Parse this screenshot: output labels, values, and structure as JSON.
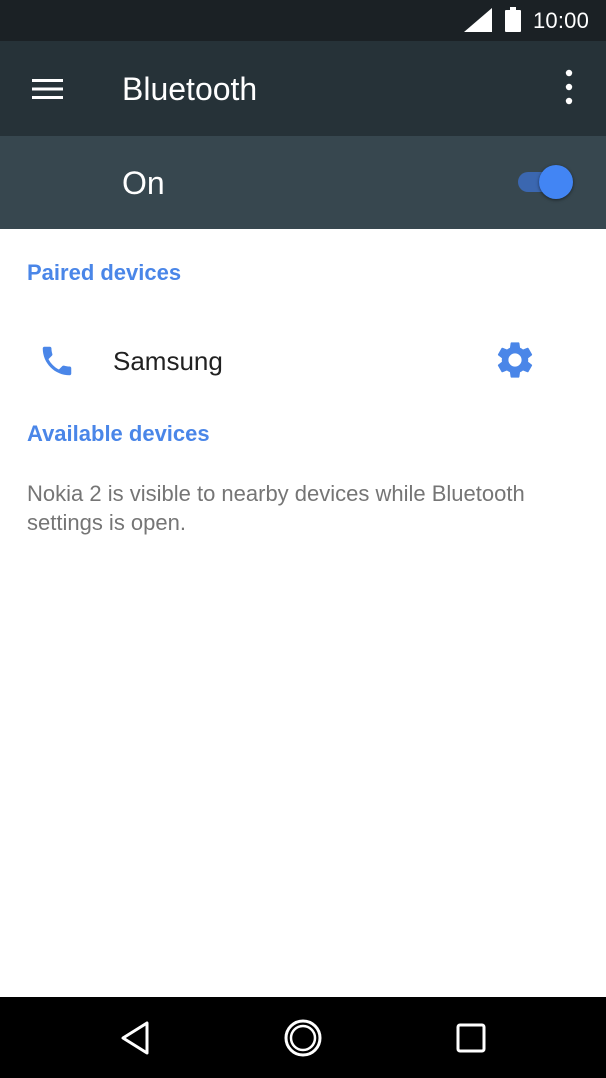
{
  "status_bar": {
    "time": "10:00",
    "signal_icon": "cellular-signal-icon",
    "battery_icon": "battery-full-icon"
  },
  "app_bar": {
    "title": "Bluetooth",
    "menu_icon": "hamburger-menu-icon",
    "overflow_icon": "more-vert-icon"
  },
  "switch_bar": {
    "label": "On",
    "enabled": true
  },
  "paired_section": {
    "header": "Paired devices",
    "devices": [
      {
        "name": "Samsung",
        "icon": "phone-icon",
        "action_icon": "gear-icon"
      }
    ]
  },
  "available_section": {
    "header": "Available devices",
    "note": "Nokia 2 is visible to nearby devices while Bluetooth settings is open."
  },
  "nav_bar": {
    "back_icon": "back-triangle-icon",
    "home_icon": "home-circle-icon",
    "recents_icon": "recents-square-icon"
  },
  "colors": {
    "status_bar": "#1b2125",
    "app_bar": "#263238",
    "switch_bar": "#37474f",
    "accent": "#4a86e8",
    "toggle_thumb": "#4285f4"
  }
}
